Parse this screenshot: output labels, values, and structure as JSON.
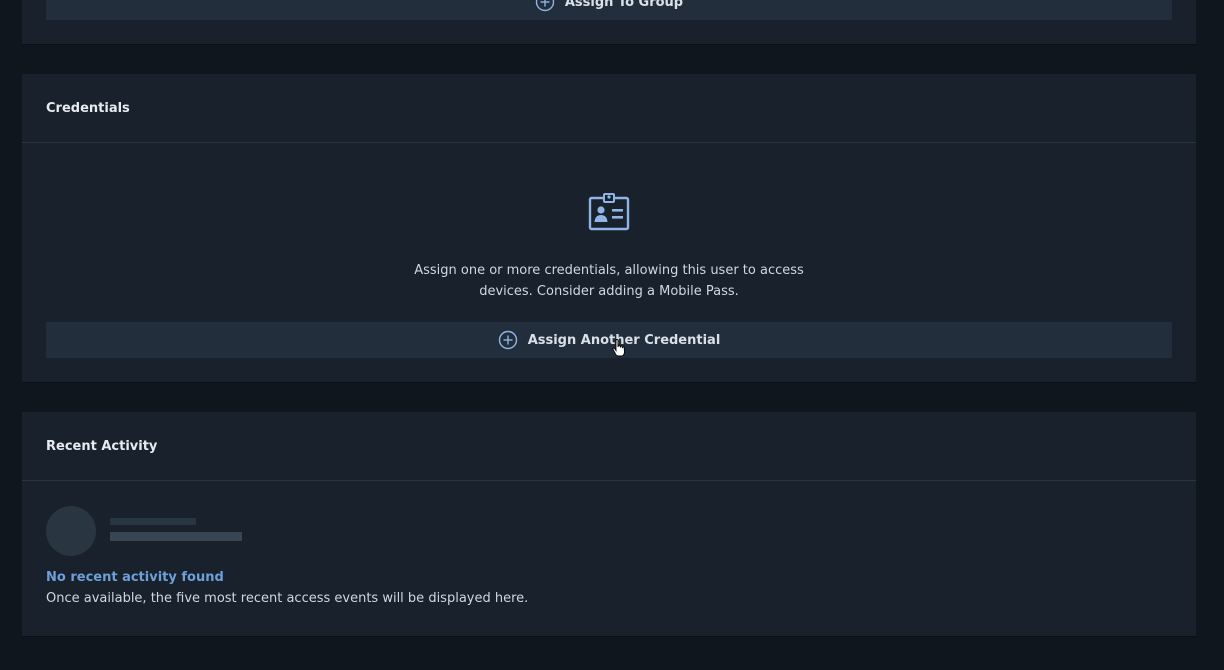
{
  "group_section": {
    "assign_button_label": "Assign To Group"
  },
  "credentials": {
    "title": "Credentials",
    "empty_line_1": "Assign one or more credentials, allowing this user to access",
    "empty_line_2": "devices. Consider adding a Mobile Pass.",
    "assign_button_label": "Assign Another Credential",
    "icon": "id-badge-icon"
  },
  "recent_activity": {
    "title": "Recent Activity",
    "empty_title": "No recent activity found",
    "empty_description": "Once available, the five most recent access events will be displayed here."
  },
  "colors": {
    "background": "#0f161e",
    "card": "#18212c",
    "button": "#222e3b",
    "accent": "#6f9fd8",
    "icon": "#8fb4e6"
  }
}
